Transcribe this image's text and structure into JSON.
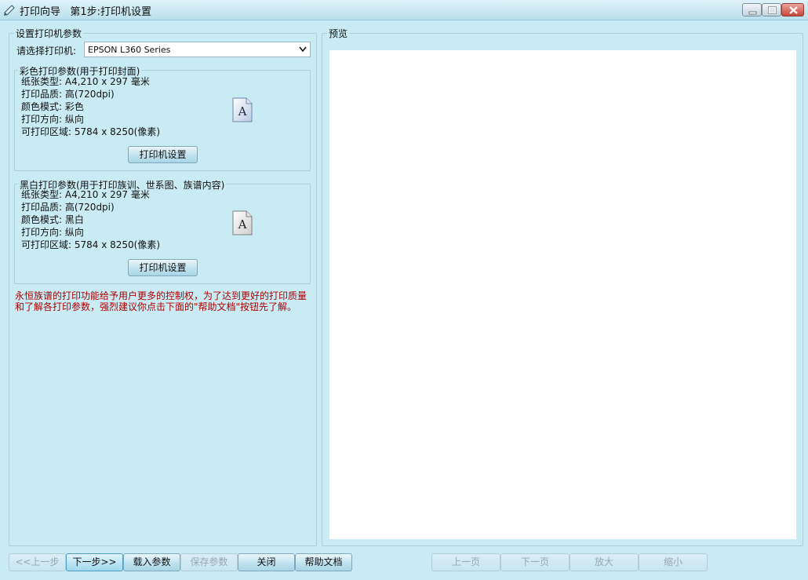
{
  "window": {
    "title": "打印向导   第1步:打印机设置",
    "controls": [
      "minimize-icon",
      "maximize-icon",
      "close-icon"
    ]
  },
  "printer_group": {
    "title": "设置打印机参数",
    "select_label": "请选择打印机:",
    "selected_printer": "EPSON L360 Series"
  },
  "color_group": {
    "title": "彩色打印参数(用于打印封面)",
    "lines": [
      "纸张类型: A4,210 x 297 毫米",
      "打印品质: 高(720dpi)",
      "颜色模式: 彩色",
      "打印方向: 纵向",
      "可打印区域: 5784 x 8250(像素)"
    ],
    "icon": "document-a-icon",
    "button": "打印机设置"
  },
  "bw_group": {
    "title": "黑白打印参数(用于打印族训、世系图、族谱内容)",
    "lines": [
      "纸张类型: A4,210 x 297 毫米",
      "打印品质: 高(720dpi)",
      "颜色模式: 黑白",
      "打印方向: 纵向",
      "可打印区域: 5784 x 8250(像素)"
    ],
    "icon": "document-a-icon",
    "button": "打印机设置"
  },
  "warning": {
    "line1": "永恒族谱的打印功能给予用户更多的控制权，为了达到更好的打印质量",
    "line2": "和了解各打印参数，强烈建议你点击下面的\"帮助文档\"按钮先了解。",
    "color": "#b00000"
  },
  "preview": {
    "title": "预览"
  },
  "bottom_left_buttons": {
    "prev": "<<上一步",
    "next": "下一步>>",
    "load": "载入参数",
    "save": "保存参数",
    "close": "关闭",
    "help": "帮助文档"
  },
  "bottom_right_buttons": {
    "prev_page": "上一页",
    "next_page": "下一页",
    "zoom_in": "放大",
    "zoom_out": "缩小"
  },
  "colors": {
    "background": "#c9ebf3",
    "warning_text": "#b00000",
    "preview_canvas": "#ffffff"
  }
}
